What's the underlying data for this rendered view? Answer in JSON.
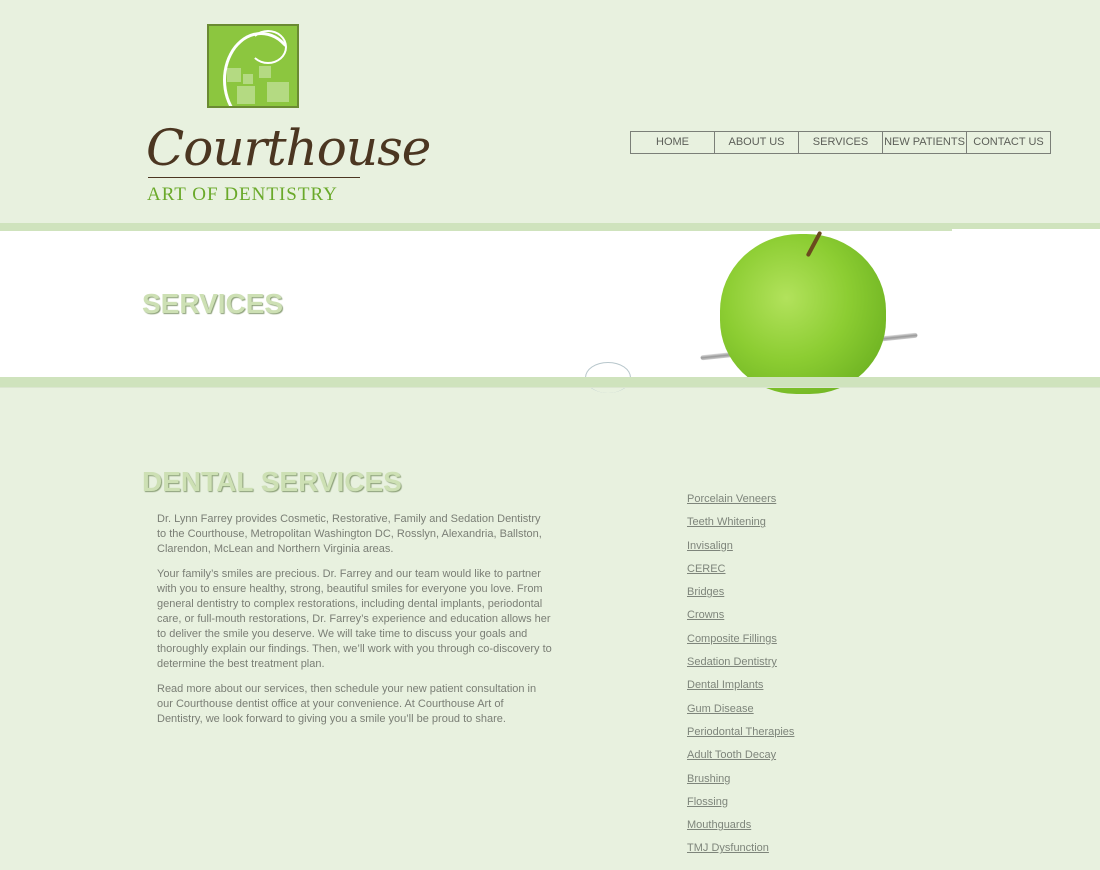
{
  "logo": {
    "script": "Courthouse",
    "subtitle": "ART OF DENTISTRY"
  },
  "nav": {
    "items": [
      {
        "label": "HOME"
      },
      {
        "label": "ABOUT US"
      },
      {
        "label": "SERVICES"
      },
      {
        "label": "NEW PATIENTS"
      },
      {
        "label": "CONTACT US"
      }
    ]
  },
  "banner": {
    "title": "SERVICES"
  },
  "main": {
    "title": "DENTAL SERVICES",
    "paragraphs": [
      "Dr. Lynn Farrey provides Cosmetic, Restorative, Family and Sedation Dentistry to the Courthouse, Metropolitan Washington DC, Rosslyn, Alexandria, Ballston, Clarendon, McLean and Northern Virginia areas.",
      "Your family’s smiles are precious. Dr. Farrey and our team would like to partner with you to ensure healthy, strong, beautiful smiles for everyone you love. From general dentistry to complex restorations, including dental implants, periodontal care, or full-mouth restorations, Dr. Farrey’s experience and education allows her to deliver the smile you deserve. We will take time to discuss your goals and thoroughly explain our findings. Then, we’ll work with you through co-discovery to determine the best treatment plan.",
      "Read more about our services, then schedule your new patient consultation in our Courthouse dentist office at your convenience. At Courthouse Art of Dentistry, we look forward to giving you a smile you’ll be proud to share."
    ]
  },
  "services": [
    "Porcelain Veneers",
    "Teeth Whitening",
    "Invisalign",
    "CEREC",
    "Bridges",
    "Crowns",
    "Composite Fillings",
    "Sedation Dentistry",
    "Dental Implants",
    "Gum Disease",
    "Periodontal Therapies",
    "Adult Tooth Decay",
    "Brushing",
    "Flossing",
    "Mouthguards",
    "TMJ Dysfunction"
  ],
  "colors": {
    "background": "#e8f1df",
    "accent_green": "#8cc63f",
    "logo_brown": "#4b3621",
    "heading_green": "#cde0b4"
  }
}
